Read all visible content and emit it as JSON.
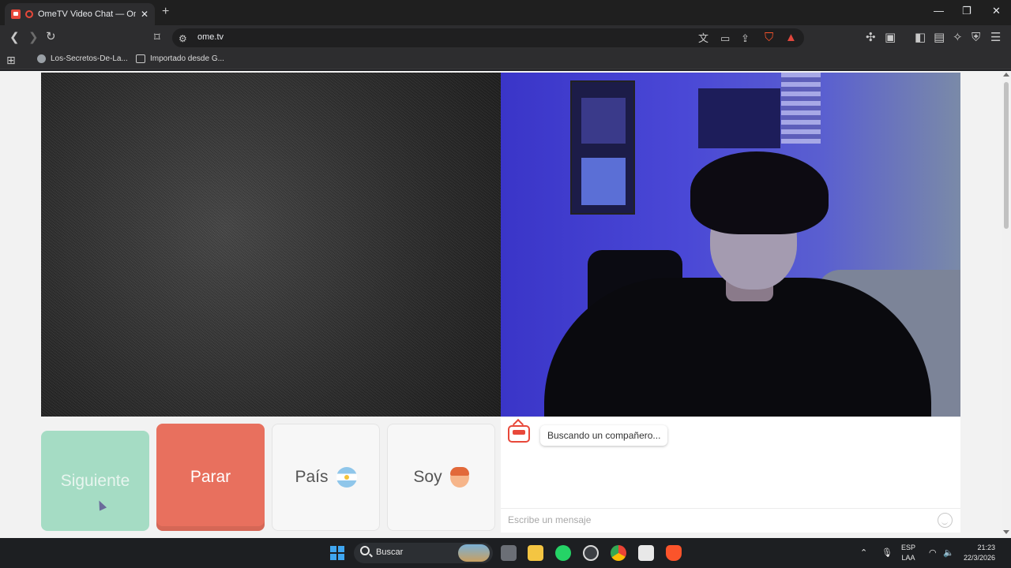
{
  "browser": {
    "tab_title": "OmeTV Video Chat — Omegle",
    "tab_close": "✕",
    "new_tab": "+",
    "url": "ome.tv",
    "window_controls": {
      "minimize": "—",
      "maximize": "❐",
      "close": "✕"
    },
    "bookmarks": [
      {
        "label": "Los-Secretos-De-La..."
      },
      {
        "label": "Importado desde G..."
      }
    ]
  },
  "controls": {
    "next_label": "Siguiente",
    "stop_label": "Parar",
    "country_label": "País",
    "gender_label": "Soy"
  },
  "chat": {
    "status_message": "Buscando un compañero...",
    "input_placeholder": "Escribe un mensaje"
  },
  "taskbar": {
    "search_label": "Buscar",
    "language_line1": "ESP",
    "language_line2": "LAA",
    "time": "21:23",
    "date": "22/3/2026"
  },
  "colors": {
    "next_button": "#a5dcc4",
    "stop_button": "#e8705e",
    "brand_red": "#e8483a"
  }
}
